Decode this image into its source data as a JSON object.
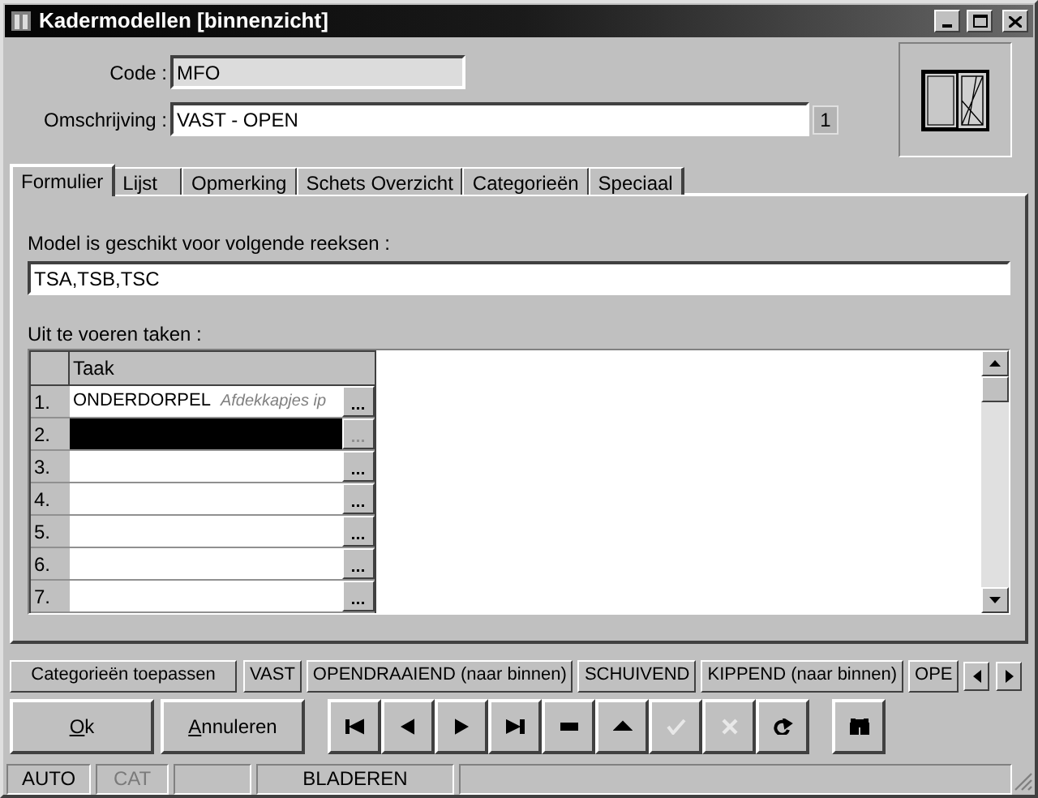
{
  "window": {
    "title": "Kadermodellen [binnenzicht]"
  },
  "header": {
    "code_label": "Code :",
    "code_value": "MFO",
    "description_label": "Omschrijving :",
    "description_value": "VAST - OPEN",
    "description_badge": "1"
  },
  "tabs": [
    {
      "label": "Formulier",
      "selected": true
    },
    {
      "label": "Lijst",
      "selected": false
    },
    {
      "label": "Opmerking",
      "selected": false
    },
    {
      "label": "Schets Overzicht",
      "selected": false
    },
    {
      "label": "Categorieën",
      "selected": false
    },
    {
      "label": "Speciaal",
      "selected": false
    }
  ],
  "form": {
    "series_label": "Model is geschikt voor volgende reeksen :",
    "series_value": "TSA,TSB,TSC",
    "tasks_label": "Uit te voeren taken :"
  },
  "task_grid": {
    "column": "Taak",
    "rows": [
      {
        "number": "1.",
        "task": "ONDERDORPEL",
        "note": "Afdekkapjes ip",
        "selected": false
      },
      {
        "number": "2.",
        "selected": true
      },
      {
        "number": "3.",
        "selected": false
      },
      {
        "number": "4.",
        "selected": false
      },
      {
        "number": "5.",
        "selected": false
      },
      {
        "number": "6.",
        "selected": false
      },
      {
        "number": "7.",
        "selected": false
      }
    ]
  },
  "category_bar": {
    "apply_button": "Categorieën toepassen",
    "categories": [
      "VAST",
      "OPENDRAAIEND (naar binnen)",
      "SCHUIVEND",
      "KIPPEND (naar binnen)",
      "OPE"
    ]
  },
  "buttons": [
    {
      "label": "Ok",
      "underline_first": true
    },
    {
      "label": "Annuleren",
      "underline_first": true
    }
  ],
  "toolbar": [
    {
      "kind": "first",
      "disabled": false
    },
    {
      "kind": "prev",
      "disabled": false
    },
    {
      "kind": "next",
      "disabled": false
    },
    {
      "kind": "last",
      "disabled": false
    },
    {
      "kind": "delete",
      "disabled": false
    },
    {
      "kind": "up",
      "disabled": false
    },
    {
      "kind": "confirm",
      "disabled": true
    },
    {
      "kind": "cancel",
      "disabled": true
    },
    {
      "kind": "refresh",
      "disabled": false
    },
    {
      "kind": "find",
      "disabled": false
    }
  ],
  "status_bar": [
    {
      "text": "AUTO",
      "disabled": false
    },
    {
      "text": "CAT",
      "disabled": true
    },
    {
      "text": "BLADEREN",
      "disabled": false
    }
  ]
}
